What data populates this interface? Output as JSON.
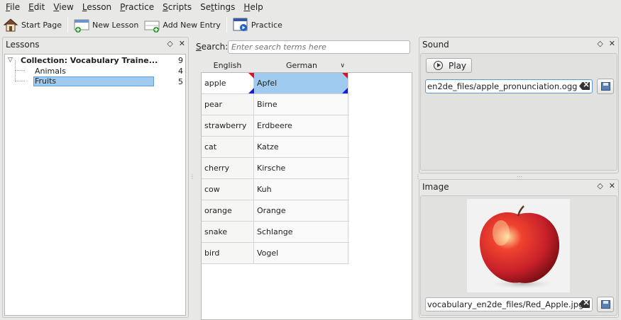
{
  "menubar": {
    "items": [
      {
        "label": "File",
        "u": "F",
        "rest": "ile"
      },
      {
        "label": "Edit",
        "u": "E",
        "rest": "dit"
      },
      {
        "label": "View",
        "u": "V",
        "rest": "iew"
      },
      {
        "label": "Lesson",
        "u": "L",
        "rest": "esson"
      },
      {
        "label": "Practice",
        "u": "P",
        "rest": "ractice"
      },
      {
        "label": "Scripts",
        "u": "S",
        "rest": "cripts"
      },
      {
        "label": "Settings",
        "pre": "Se",
        "u": "t",
        "rest": "tings"
      },
      {
        "label": "Help",
        "u": "H",
        "rest": "elp"
      }
    ]
  },
  "toolbar": {
    "start_page": "Start Page",
    "new_lesson": "New Lesson",
    "add_new_entry": "Add New Entry",
    "practice": "Practice"
  },
  "lessons": {
    "title": "Lessons",
    "root": {
      "label": "Collection: Vocabulary Traine...",
      "count": "9"
    },
    "items": [
      {
        "label": "Animals",
        "count": "4"
      },
      {
        "label": "Fruits",
        "count": "5"
      }
    ]
  },
  "search": {
    "label": "Search:",
    "placeholder": "Enter search terms here"
  },
  "table": {
    "columns": [
      "English",
      "German"
    ],
    "rows": [
      {
        "en": "apple",
        "de": "Apfel"
      },
      {
        "en": "pear",
        "de": "Birne"
      },
      {
        "en": "strawberry",
        "de": "Erdbeere"
      },
      {
        "en": "cat",
        "de": "Katze"
      },
      {
        "en": "cherry",
        "de": "Kirsche"
      },
      {
        "en": "cow",
        "de": "Kuh"
      },
      {
        "en": "orange",
        "de": "Orange"
      },
      {
        "en": "snake",
        "de": "Schlange"
      },
      {
        "en": "bird",
        "de": "Vogel"
      }
    ]
  },
  "sound": {
    "title": "Sound",
    "play_label": "Play",
    "path": "en2de_files/apple_pronunciation.ogg"
  },
  "image": {
    "title": "Image",
    "path": "vocabulary_en2de_files/Red_Apple.jpg"
  },
  "colors": {
    "selection": "#9ecbef",
    "corner_red": "#e01020",
    "corner_blue": "#1a1adf",
    "apple_red": "#c8202a"
  }
}
